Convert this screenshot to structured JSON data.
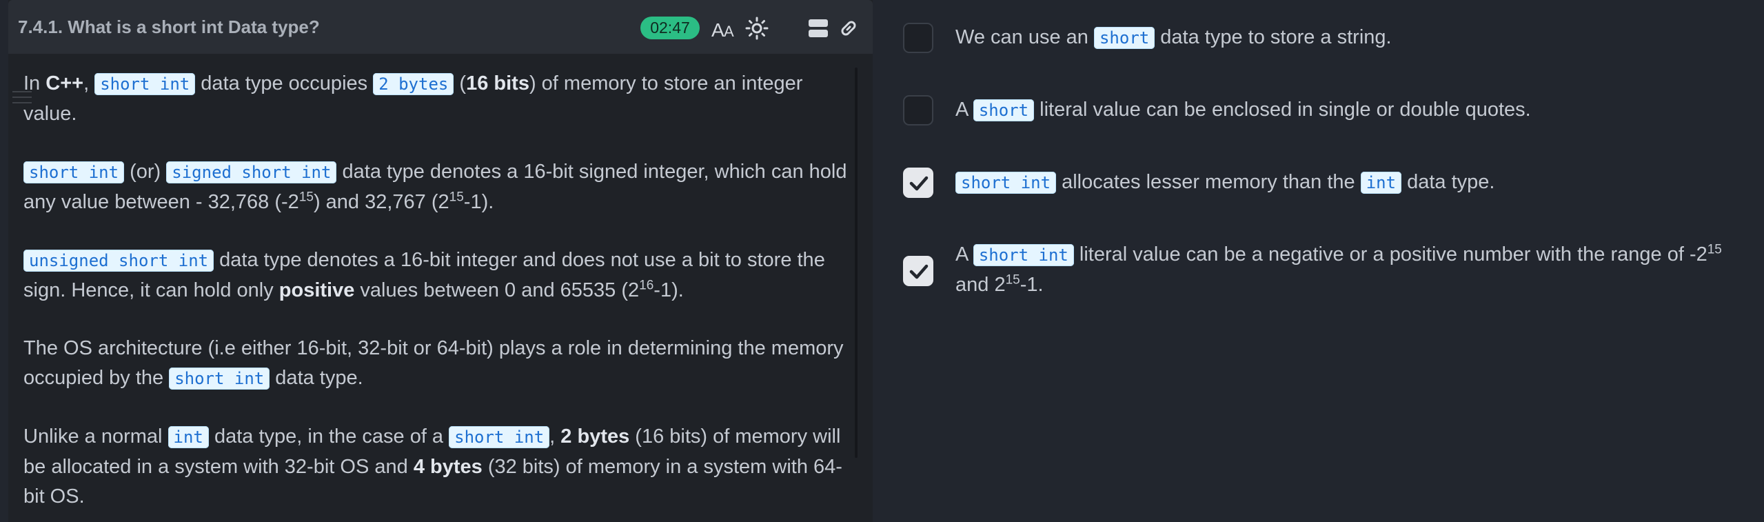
{
  "header": {
    "title": "7.4.1. What is a short int Data type?",
    "timer": "02:47",
    "icons": [
      "font-size-icon",
      "theme-toggle-icon",
      "layout-toggle-icon",
      "link-icon"
    ]
  },
  "content": {
    "p1": {
      "t1": "In ",
      "b1": "C++",
      "t2": ", ",
      "c1": "short int",
      "t3": " data type occupies ",
      "c2": "2 bytes",
      "t4": " (",
      "b2": "16 bits",
      "t5": ") of memory to store an integer value."
    },
    "p2": {
      "c1": "short int",
      "t1": " (or) ",
      "c2": "signed short int",
      "t2": " data type denotes a 16-bit signed integer, which can hold any value between - 32,768 (-2",
      "s1": "15",
      "t3": ") and 32,767 (2",
      "s2": "15",
      "t4": "-1)."
    },
    "p3": {
      "c1": "unsigned short int",
      "t1": " data type denotes a 16-bit integer and does not use a bit to store the sign. Hence, it can hold only ",
      "b1": "positive",
      "t2": " values between 0 and 65535 (2",
      "s1": "16",
      "t3": "-1)."
    },
    "p4": {
      "t1": "The OS architecture (i.e either 16-bit, 32-bit or 64-bit) plays a role in determining the memory occupied by the ",
      "c1": "short int",
      "t2": " data type."
    },
    "p5": {
      "t1": "Unlike a normal ",
      "c1": "int",
      "t2": " data type, in the case of a ",
      "c2": "short int",
      "t3": ", ",
      "b1": "2 bytes",
      "t4": " (16 bits) of memory will be allocated in a system with 32-bit OS and ",
      "b2": "4 bytes",
      "t5": " (32 bits) of memory in a system with 64-bit OS."
    }
  },
  "options": [
    {
      "checked": false,
      "t1": "We can use an ",
      "c1": "short",
      "t2": " data type to store a string."
    },
    {
      "checked": false,
      "t1": "A ",
      "c1": "short",
      "t2": " literal value can be enclosed in single or double quotes."
    },
    {
      "checked": true,
      "c1": "short int",
      "t1": " allocates lesser memory than the ",
      "c2": "int",
      "t2": " data type."
    },
    {
      "checked": true,
      "t1": "A ",
      "c1": "short int",
      "t2": " literal value can be a negative or a positive number with the range of -2",
      "s1": "15",
      "t3": " and 2",
      "s2": "15",
      "t4": "-1."
    }
  ],
  "colors": {
    "timer_bg": "#2bbd84",
    "code_bg": "#e5f5ff",
    "code_text": "#1d6fd1",
    "checkbox_checked": "#e6e8ec"
  }
}
